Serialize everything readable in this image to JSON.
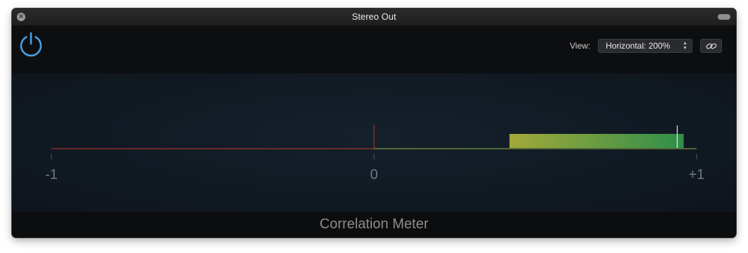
{
  "window": {
    "title": "Stereo Out",
    "close_icon": "close-icon",
    "collapse_icon": "collapse-icon"
  },
  "header": {
    "power_icon": "power-icon",
    "view_label": "View:",
    "view_value": "Horizontal: 200%",
    "link_icon": "link-icon"
  },
  "meter": {
    "scale_labels": [
      "-1",
      "0",
      "+1"
    ],
    "range": [
      -1,
      1
    ],
    "current_low": 0.42,
    "current_high": 0.96,
    "peak": 0.94,
    "colors": {
      "negative_line": "#c0392b",
      "positive_line": "#8bb84a",
      "center_marker": "#c0392b",
      "bar_start": "#a3a83a",
      "bar_end": "#2f8f4a",
      "peak_marker": "#e8e8e8"
    }
  },
  "footer": {
    "name": "Correlation Meter"
  }
}
